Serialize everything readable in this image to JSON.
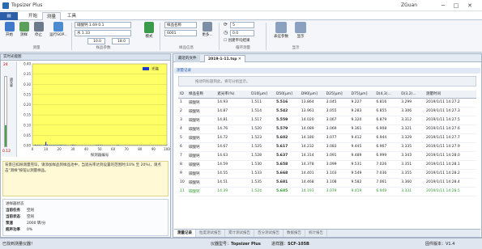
{
  "app": {
    "title": "Topsizer Plus",
    "user": "ZGuan",
    "win_min": "─",
    "win_max": "□",
    "win_close": "✕"
  },
  "ribbon_tabs": {
    "file": "",
    "home": "开始",
    "measure": "测量",
    "tools": "工具"
  },
  "ribbon": {
    "start_label": "开始",
    "measure_label": "测样",
    "stop_label": "停止",
    "run_sop_label": "运行SOP...",
    "group_measure": "测量",
    "refractive_index": "硝酸钙 1.69 0.1",
    "refractive_water": "水 1.33",
    "obscuration_min": "10.0",
    "obscuration_max": "18.0",
    "group_sample_params": "样品参数",
    "mode_label": "模式",
    "sample_name": "样品名称",
    "sample_number": "0001",
    "group_sample_info": "样品信息",
    "more_label": "更多...",
    "cycle_count": "5",
    "interval": "0.0",
    "create_avg_label": "创建平均结果",
    "group_cycle": "循环测量",
    "custom_params_label": "表征参数",
    "display_label": "显示",
    "group_display": "显示"
  },
  "left": {
    "panel_title": "实时光能图",
    "legend": "光能",
    "side_top": "24",
    "side_label": "遮光率",
    "side_bottom": "0.12",
    "xaxis_label": "探测器编号",
    "yticks": [
      "0.40",
      "0.35",
      "0.30",
      "0.25",
      "0.20",
      "0.15",
      "0.10",
      "0.05",
      "0.00"
    ],
    "xticks": [
      "0",
      "10",
      "20",
      "30",
      "40",
      "50",
      "60",
      "70",
      "80",
      "90",
      "100"
    ],
    "hint": "背景已扣除测量完毕，请添加样品到样品池中，当遮光率达到设置的范围时(10% 至 20%)，请点击\"测样\"按钮以测量样品。",
    "status_title": "进样器状态",
    "status": [
      {
        "k": "当前任务",
        "v": "空闲"
      },
      {
        "k": "当前状态",
        "v": "空闲"
      },
      {
        "k": "泵速",
        "v": "2000 转/分"
      },
      {
        "k": "超声功率",
        "v": "0%"
      }
    ]
  },
  "right": {
    "tabs": [
      "最近的文件",
      "2019-1-11.tsp"
    ],
    "tab_close": "✕",
    "panel_title": "测量记录",
    "group_hint": "拖动列标题到此，将可分组显示。",
    "columns": [
      "ID",
      "样品名称",
      "遮光率(%)",
      "D10[μm]",
      "D50[μm]",
      "D90[μm]",
      "D25[μm]",
      "D75[μm]",
      "D(4,3)...",
      "D(3,2)...",
      "测量时间"
    ],
    "rows": [
      [
        "1",
        "碳酸钙",
        "14.93",
        "1.511",
        "5.516",
        "13.864",
        "3.045",
        "9.227",
        "6.816",
        "3.299",
        "2019/1/11 14:27.2"
      ],
      [
        "2",
        "碳酸钙",
        "14.87",
        "1.514",
        "5.542",
        "13.961",
        "3.055",
        "9.283",
        "6.855",
        "3.306",
        "2019/1/11 14:27.3"
      ],
      [
        "3",
        "碳酸钙",
        "14.81",
        "1.517",
        "5.559",
        "14.020",
        "3.067",
        "9.320",
        "6.879",
        "3.312",
        "2019/1/11 14:27.5"
      ],
      [
        "4",
        "碳酸钙",
        "14.76",
        "1.520",
        "5.579",
        "14.089",
        "3.069",
        "9.361",
        "6.908",
        "3.321",
        "2019/1/11 14:27.6"
      ],
      [
        "5",
        "碳酸钙",
        "14.72",
        "1.523",
        "5.602",
        "14.180",
        "3.077",
        "9.412",
        "6.944",
        "3.329",
        "2019/1/11 14:27.7"
      ],
      [
        "6",
        "碳酸钙",
        "14.67",
        "1.525",
        "5.617",
        "14.232",
        "3.083",
        "9.445",
        "6.967",
        "3.335",
        "2019/1/11 14:27.9"
      ],
      [
        "7",
        "碳酸钙",
        "14.63",
        "1.528",
        "5.637",
        "14.314",
        "3.091",
        "9.489",
        "6.999",
        "3.343",
        "2019/1/11 14:28.0"
      ],
      [
        "8",
        "碳酸钙",
        "14.59",
        "1.530",
        "5.658",
        "14.378",
        "3.099",
        "9.531",
        "7.026",
        "3.351",
        "2019/1/11 14:28.1"
      ],
      [
        "9",
        "碳酸钙",
        "14.55",
        "1.533",
        "5.668",
        "14.401",
        "3.103",
        "9.549",
        "7.036",
        "3.355",
        "2019/1/11 14:28.2"
      ],
      [
        "10",
        "碳酸钙",
        "14.51",
        "1.535",
        "5.681",
        "14.468",
        "3.108",
        "9.582",
        "7.061",
        "3.360",
        "2019/1/11 14:28.4"
      ],
      [
        "11",
        "碳酸钙",
        "14.39",
        "1.524",
        "5.685",
        "14.191",
        "3.079",
        "9.419",
        "6.949",
        "3.331",
        "2019/1/11 14:28.5"
      ]
    ],
    "bottom_tabs": [
      "测量记录",
      "粒度测试报告",
      "累计测试报告",
      "百分测试报告",
      "数据报告",
      "统计报告"
    ]
  },
  "statusbar": {
    "left": "已找到测量仪器！",
    "device_label": "仪器型号：",
    "device": "Topsizer Plus",
    "serial_label": "进样器：",
    "serial": "SCF-105B",
    "version_label": "固件版本：",
    "version": "V1.4"
  },
  "chart_data": {
    "type": "bar",
    "xlabel": "探测器编号",
    "ylabel": "",
    "ylim": [
      0,
      0.4
    ],
    "xlim": [
      0,
      100
    ],
    "series": [
      {
        "name": "光能",
        "x": [
          1,
          2,
          3,
          4,
          5,
          6,
          7,
          8,
          9,
          10,
          11,
          12,
          13,
          14,
          15,
          16,
          17,
          18,
          19,
          20,
          21,
          22,
          23,
          24,
          25,
          26,
          27,
          28,
          29,
          30,
          31,
          32,
          33,
          34,
          35,
          36,
          37,
          38,
          39,
          40,
          41,
          42,
          43,
          44,
          45,
          46,
          47,
          48,
          49,
          50,
          51,
          52,
          53,
          54,
          55,
          56,
          57,
          58,
          59,
          60,
          61,
          62,
          63,
          64,
          65,
          66,
          67,
          68,
          69,
          70,
          71,
          72,
          73,
          74,
          75,
          76,
          77,
          78,
          79,
          80,
          81,
          82,
          83,
          84,
          85,
          86,
          87,
          88,
          89,
          90,
          91,
          92,
          93,
          94,
          95,
          96,
          97,
          98,
          99,
          100
        ],
        "values": [
          0.002,
          0.004,
          0.003,
          0.003,
          0.003,
          0.003,
          0.002,
          0.002,
          0.004,
          0.018,
          0.005,
          0.003,
          0.003,
          0.003,
          0.003,
          0.003,
          0.003,
          0.003,
          0.003,
          0.003,
          0.004,
          0.003,
          0.003,
          0.003,
          0.003,
          0.002,
          0.002,
          0.002,
          0.003,
          0.004,
          0.003,
          0.003,
          0.002,
          0.002,
          0.002,
          0.002,
          0.002,
          0.002,
          0.002,
          0.002,
          0.002,
          0.002,
          0.002,
          0.002,
          0.002,
          0.002,
          0.003,
          0.003,
          0.003,
          0.003,
          0.003,
          0.003,
          0.002,
          0.002,
          0.002,
          0.002,
          0.002,
          0.002,
          0.002,
          0.002,
          0.002,
          0.002,
          0.003,
          0.003,
          0.002,
          0.002,
          0.002,
          0.002,
          0.002,
          0.002,
          0.002,
          0.002,
          0.002,
          0.002,
          0.002,
          0.002,
          0.002,
          0.002,
          0.002,
          0.002,
          0.002,
          0.002,
          0.002,
          0.002,
          0.002,
          0.002,
          0.002,
          0.002,
          0.002,
          0.002,
          0.002,
          0.002,
          0.002,
          0.002,
          0.002,
          0.002,
          0.002,
          0.002,
          0.002,
          0.002
        ]
      }
    ]
  },
  "colors": {
    "chart_bg": "#ffff66",
    "bar": "#1f3cc8",
    "accent": "#2c5fa8",
    "last_row": "#2e9a2e"
  }
}
